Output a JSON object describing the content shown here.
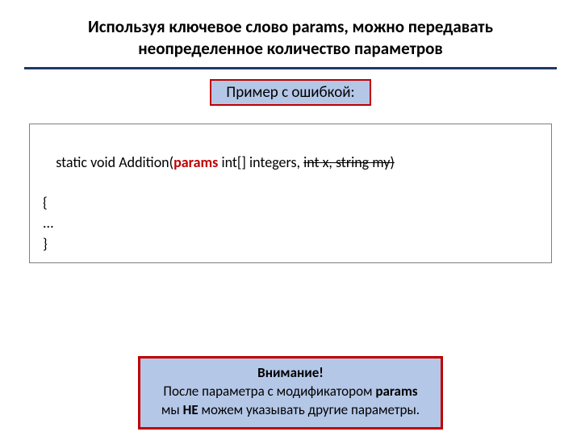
{
  "title": "Используя ключевое слово params, можно передавать неопределенное количество параметров",
  "subtitle": "Пример с ошибкой:",
  "code": {
    "line1_prefix": "static void Addition(",
    "line1_keyword": "params",
    "line1_mid": " int[] integers, ",
    "line1_strike": "int x, string my)",
    "line2": "{",
    "line3": "...",
    "line4": "}"
  },
  "attention": {
    "heading": "Внимание!",
    "line2_a": "После параметра с модификатором ",
    "line2_b": "params",
    "line3_a": "мы ",
    "line3_b": "НЕ",
    "line3_c": " можем указывать другие параметры."
  }
}
